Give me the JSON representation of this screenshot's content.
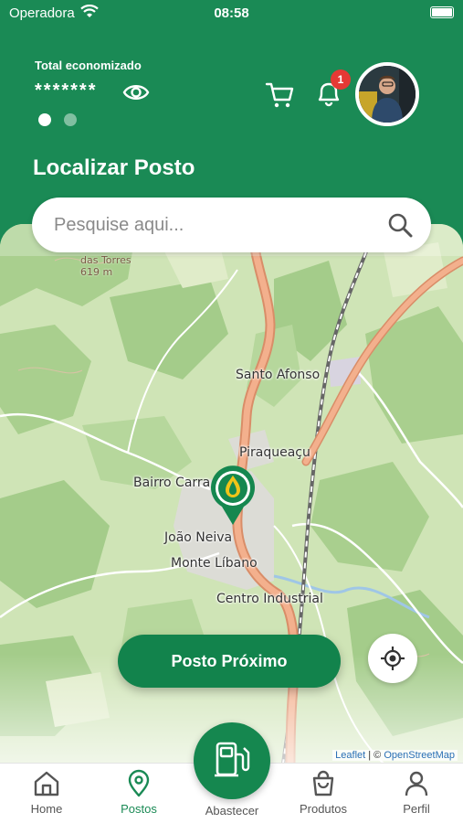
{
  "status_bar": {
    "carrier": "Operadora",
    "time": "08:58"
  },
  "header": {
    "saved_label": "Total economizado",
    "saved_value": "*******",
    "notification_count": "1",
    "title": "Localizar Posto"
  },
  "search": {
    "placeholder": "Pesquise aqui..."
  },
  "map": {
    "labels": {
      "peak_name": "das Torres",
      "peak_elevation": "619 m",
      "santo_afonso": "Santo Afonso",
      "piraquecu": "Piraqueaçu",
      "bairro_carra": "Bairro Carra",
      "joao_neiva": "João Neiva",
      "monte_libano": "Monte Líbano",
      "centro_industrial": "Centro Industrial"
    },
    "attribution": {
      "leaflet": "Leaflet",
      "separator": " | © ",
      "osm": "OpenStreetMap"
    }
  },
  "actions": {
    "nearest_button": "Posto Próximo"
  },
  "nav": {
    "home": "Home",
    "postos": "Postos",
    "abastecer": "Abastecer",
    "produtos": "Produtos",
    "perfil": "Perfil"
  },
  "colors": {
    "brand_green": "#1a8a55",
    "badge_red": "#e53935",
    "road_orange": "#f0a37f"
  }
}
